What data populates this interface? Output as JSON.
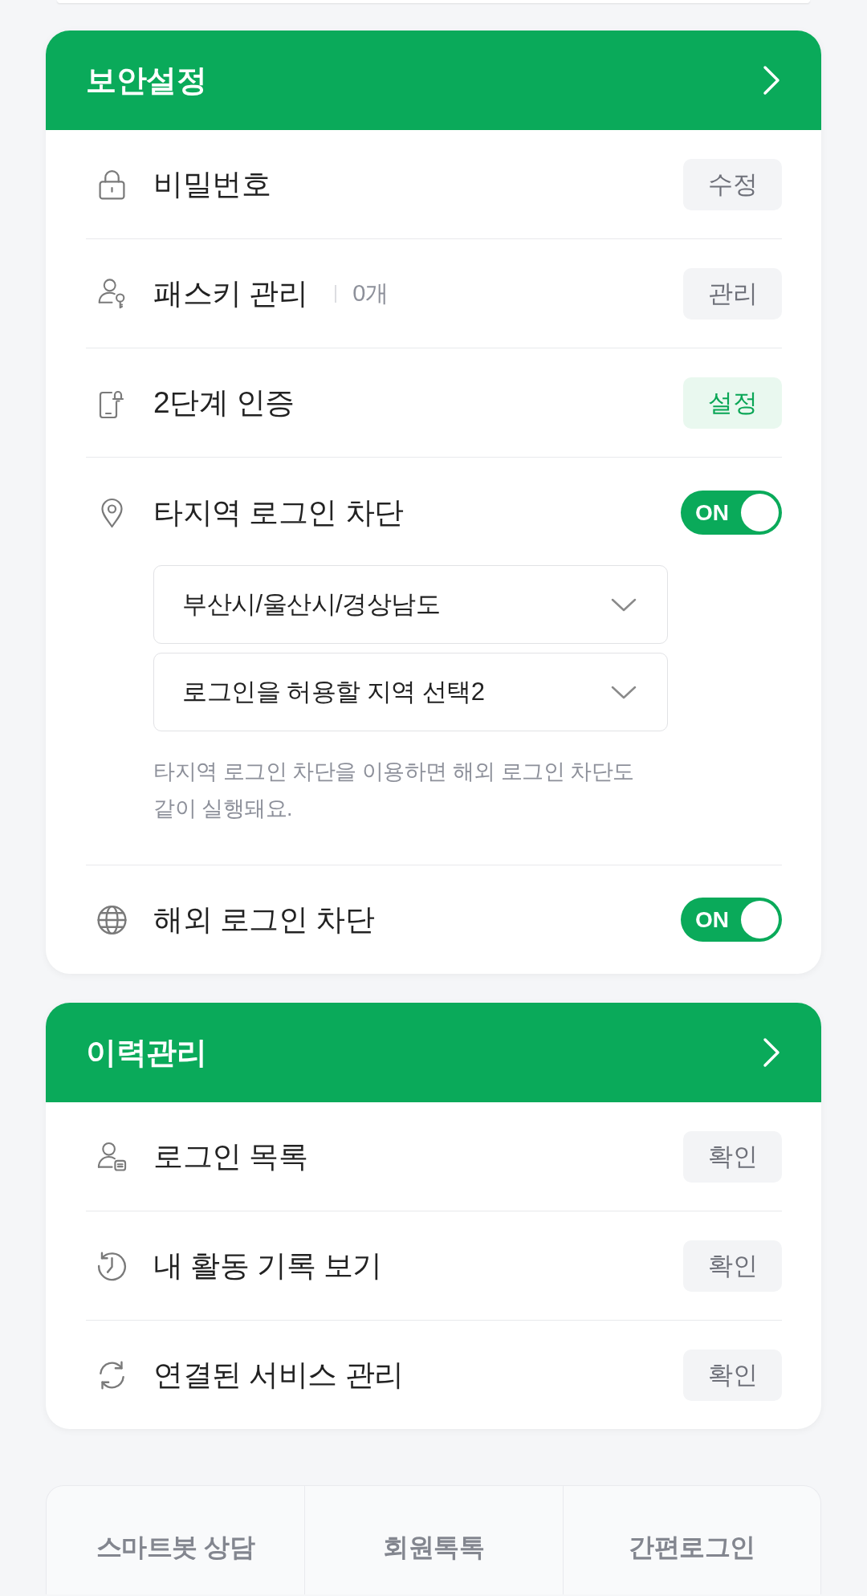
{
  "sections": [
    {
      "title": "보안설정",
      "items": [
        {
          "kind": "button",
          "label": "비밀번호",
          "button": {
            "label": "수정",
            "highlighted": false
          }
        },
        {
          "kind": "button",
          "label": "패스키 관리",
          "count": "0개",
          "button": {
            "label": "관리",
            "highlighted": false
          }
        },
        {
          "kind": "button",
          "label": "2단계 인증",
          "button": {
            "label": "설정",
            "highlighted": true
          }
        },
        {
          "kind": "toggle",
          "label": "타지역 로그인 차단",
          "toggle": {
            "on": true,
            "label": "ON"
          },
          "selects": [
            {
              "value": "부산시/울산시/경상남도"
            },
            {
              "value": "로그인을 허용할 지역 선택2"
            }
          ],
          "note": "타지역 로그인 차단을 이용하면 해외 로그인 차단도 같이 실행돼요."
        },
        {
          "kind": "toggle",
          "label": "해외 로그인 차단",
          "toggle": {
            "on": true,
            "label": "ON"
          }
        }
      ]
    },
    {
      "title": "이력관리",
      "items": [
        {
          "kind": "button",
          "label": "로그인 목록",
          "button": {
            "label": "확인",
            "highlighted": false
          }
        },
        {
          "kind": "button",
          "label": "내 활동 기록 보기",
          "button": {
            "label": "확인",
            "highlighted": false
          }
        },
        {
          "kind": "button",
          "label": "연결된 서비스 관리",
          "button": {
            "label": "확인",
            "highlighted": false
          }
        }
      ]
    }
  ],
  "footer_links": [
    "스마트봇 상담",
    "회원톡톡",
    "간편로그인"
  ]
}
